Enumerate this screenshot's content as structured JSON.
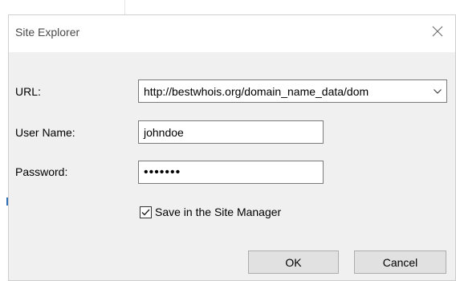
{
  "dialog": {
    "title": "Site Explorer",
    "close_icon": "close-icon"
  },
  "form": {
    "url_label": "URL:",
    "url_value": "http://bestwhois.org/domain_name_data/dom",
    "username_label": "User Name:",
    "username_value": "johndoe",
    "password_label": "Password:",
    "password_value": "•••••••",
    "save_checkbox_label": "Save in the Site Manager",
    "save_checked": true
  },
  "buttons": {
    "ok_label": "OK",
    "cancel_label": "Cancel"
  },
  "colors": {
    "dialog_bg": "#f0f0f0",
    "titlebar_bg": "#ffffff",
    "button_bg": "#e1e1e1"
  }
}
